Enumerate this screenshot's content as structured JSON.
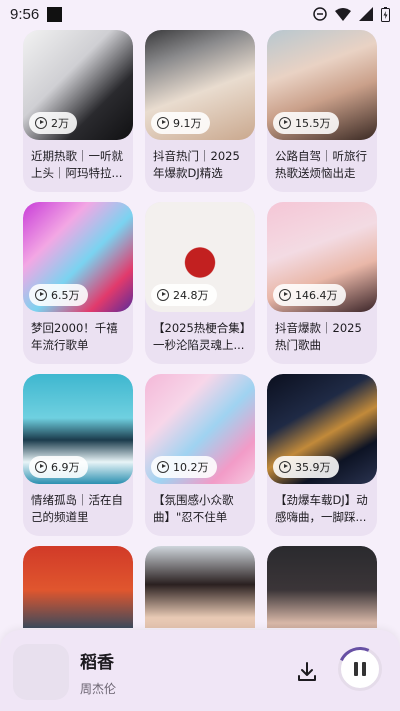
{
  "status": {
    "time": "9:56"
  },
  "playlists": [
    {
      "count": "2万",
      "title": "近期热歌｜一听就上头｜阿玛特拉..."
    },
    {
      "count": "9.1万",
      "title": "抖音热门｜2025年爆款DJ精选"
    },
    {
      "count": "15.5万",
      "title": "公路自驾｜听旅行热歌送烦恼出走"
    },
    {
      "count": "6.5万",
      "title": "梦回2000！千禧年流行歌单"
    },
    {
      "count": "24.8万",
      "title": "【2025热梗合集】一秒沦陷灵魂上..."
    },
    {
      "count": "146.4万",
      "title": "抖音爆款｜2025热门歌曲"
    },
    {
      "count": "6.9万",
      "title": "情绪孤岛｜活在自己的频道里"
    },
    {
      "count": "10.2万",
      "title": "【氛围感小众歌曲】\"忍不住单曲..."
    },
    {
      "count": "35.9万",
      "title": "【劲爆车载DJ】动感嗨曲，一脚踩..."
    },
    {
      "count": "",
      "title": ""
    },
    {
      "count": "",
      "title": ""
    },
    {
      "count": "",
      "title": ""
    }
  ],
  "now_playing": {
    "title": "稻香",
    "artist": "周杰伦"
  }
}
